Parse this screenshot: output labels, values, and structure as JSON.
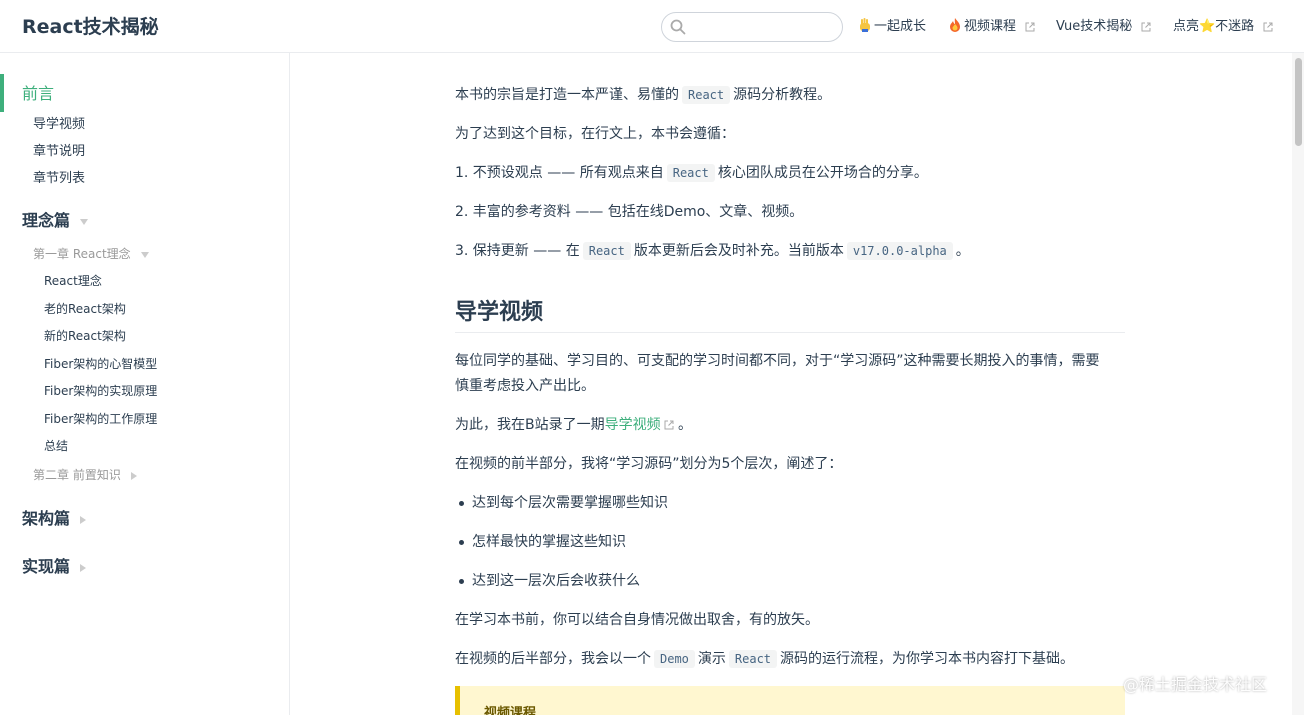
{
  "navbar": {
    "site_name": "React技术揭秘",
    "search_placeholder": "",
    "links": [
      {
        "label": "一起成长",
        "prefix_icon": "raised-hand-emoji",
        "external": false
      },
      {
        "label": "视频课程",
        "prefix_icon": "fire-emoji",
        "external": true
      },
      {
        "label": "Vue技术揭秘",
        "external": true
      },
      {
        "label": "点亮⭐不迷路",
        "external": true
      }
    ]
  },
  "sidebar": {
    "intro": {
      "title": "前言",
      "items": [
        "导学视频",
        "章节说明",
        "章节列表"
      ]
    },
    "concept": {
      "title": "理念篇",
      "chapter1": {
        "title": "第一章 React理念",
        "items": [
          "React理念",
          "老的React架构",
          "新的React架构",
          "Fiber架构的心智模型",
          "Fiber架构的实现原理",
          "Fiber架构的工作原理",
          "总结"
        ]
      },
      "chapter2": {
        "title": "第二章 前置知识"
      }
    },
    "architecture": {
      "title": "架构篇"
    },
    "implementation": {
      "title": "实现篇"
    }
  },
  "content": {
    "p1": {
      "a": "本书的宗旨是打造一本严谨、易懂的",
      "code": "React",
      "b": "源码分析教程。"
    },
    "p2": "为了达到这个目标，在行文上，本书会遵循：",
    "ol": [
      {
        "a": "1. 不预设观点 —— 所有观点来自",
        "code": "React",
        "b": "核心团队成员在公开场合的分享。"
      },
      {
        "a": "2. 丰富的参考资料 —— 包括在线Demo、文章、视频。"
      },
      {
        "a": "3. 保持更新 —— 在",
        "code": "React",
        "b": "版本更新后会及时补充。当前版本",
        "code2": "v17.0.0-alpha",
        "c": "。"
      }
    ],
    "h2": "导学视频",
    "p3_line1": "每位同学的基础、学习目的、可支配的学习时间都不同，对于“学习源码”这种需要长期投入的事情，需要",
    "p3_line2": "慎重考虑投入产出比。",
    "p4": {
      "a": "为此，我在B站录了一期",
      "link": "导学视频",
      "b": " 。"
    },
    "p5": "在视频的前半部分，我将“学习源码”划分为5个层次，阐述了：",
    "ul": [
      "达到每个层次需要掌握哪些知识",
      "怎样最快的掌握这些知识",
      "达到这一层次后会收获什么"
    ],
    "p6": "在学习本书前，你可以结合自身情况做出取舍，有的放矢。",
    "p7": {
      "a": "在视频的后半部分，我会以一个",
      "code": "Demo",
      "b": "演示",
      "code2": "React",
      "c": "源码的运行流程，为你学习本书内容打下基础。"
    },
    "tip_title": "视频课程"
  },
  "watermark": "@稀土掘金技术社区",
  "colors": {
    "accent": "#3eaf7c",
    "text": "#2c3e50",
    "tip_bg": "#fff7d0",
    "tip_border": "#e7c000"
  }
}
